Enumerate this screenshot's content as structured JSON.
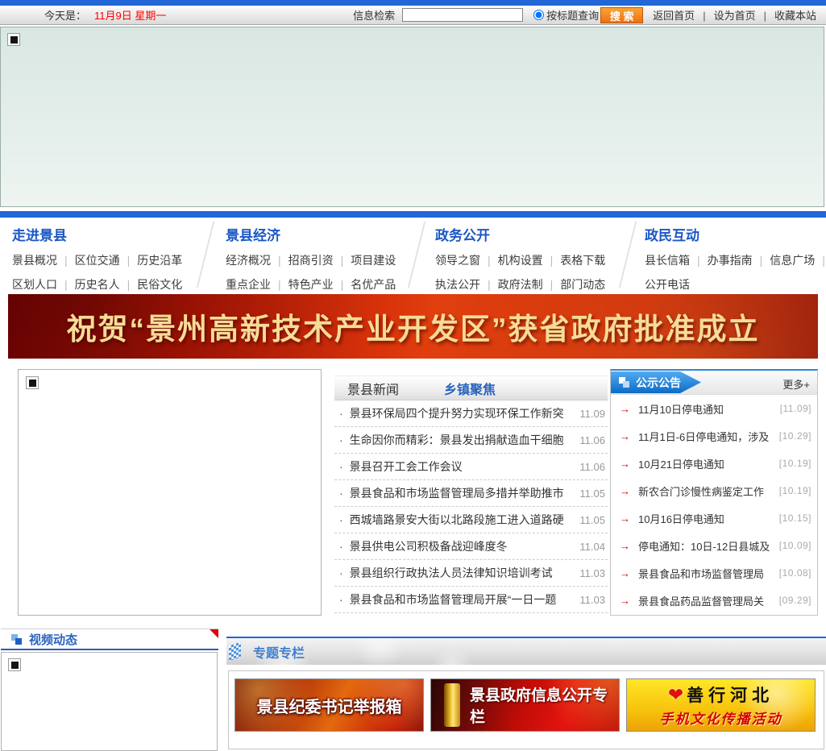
{
  "topbar": {
    "today_label": "今天是：",
    "today_value": "11月9日 星期一",
    "search_label": "信息检索",
    "radio_label": "按标题查询",
    "search_button": "搜 索",
    "links": [
      "返回首页",
      "设为首页",
      "收藏本站"
    ]
  },
  "nav": {
    "columns": [
      {
        "title": "走进景县",
        "rows": [
          [
            "景县概况",
            "区位交通",
            "历史沿革"
          ],
          [
            "区划人口",
            "历史名人",
            "民俗文化"
          ]
        ]
      },
      {
        "title": "景县经济",
        "rows": [
          [
            "经济概况",
            "招商引资",
            "项目建设"
          ],
          [
            "重点企业",
            "特色产业",
            "名优产品"
          ]
        ]
      },
      {
        "title": "政务公开",
        "rows": [
          [
            "领导之窗",
            "机构设置",
            "表格下载"
          ],
          [
            "执法公开",
            "政府法制",
            "部门动态"
          ]
        ]
      },
      {
        "title": "政民互动",
        "rows": [
          [
            "县长信箱",
            "办事指南",
            "信息广场"
          ],
          [
            "公开电话"
          ]
        ]
      }
    ]
  },
  "headline_banner": {
    "text": "祝贺“景州高新技术产业开发区”获省政府批准成立"
  },
  "news": {
    "tabs": [
      "景县新闻",
      "乡镇聚焦"
    ],
    "items": [
      {
        "title": "景县环保局四个提升努力实现环保工作新突",
        "date": "11.09"
      },
      {
        "title": "生命因你而精彩：景县发出捐献造血干细胞",
        "date": "11.06"
      },
      {
        "title": "景县召开工会工作会议",
        "date": "11.06"
      },
      {
        "title": "景县食品和市场监督管理局多措并举助推市",
        "date": "11.05"
      },
      {
        "title": "西城墙路景安大街以北路段施工进入道路硬",
        "date": "11.05"
      },
      {
        "title": "景县供电公司积极备战迎峰度冬",
        "date": "11.04"
      },
      {
        "title": "景县组织行政执法人员法律知识培训考试",
        "date": "11.03"
      },
      {
        "title": "景县食品和市场监督管理局开展“一日一题",
        "date": "11.03"
      }
    ]
  },
  "announcements": {
    "title": "公示公告",
    "more_label": "更多+",
    "items": [
      {
        "title": "11月10日停电通知",
        "date": "[11.09]"
      },
      {
        "title": "11月1日-6日停电通知，涉及",
        "date": "[10.29]"
      },
      {
        "title": "10月21日停电通知",
        "date": "[10.19]"
      },
      {
        "title": "新农合门诊慢性病鉴定工作",
        "date": "[10.19]"
      },
      {
        "title": "10月16日停电通知",
        "date": "[10.15]"
      },
      {
        "title": "停电通知：10日-12日县城及",
        "date": "[10.09]"
      },
      {
        "title": "景县食品和市场监督管理局",
        "date": "[10.08]"
      },
      {
        "title": "景县食品药品监督管理局关",
        "date": "[09.29]"
      }
    ]
  },
  "video_panel": {
    "title": "视频动态"
  },
  "special_section": {
    "title": "专题专栏",
    "banners": [
      {
        "text": "景县纪委书记举报箱"
      },
      {
        "text": "景县政府信息公开专栏"
      },
      {
        "line1": "善行河北",
        "line2": "手机文化传播活动"
      }
    ]
  },
  "icons": {
    "bullet": "·",
    "arrow": "→",
    "heart": "❤"
  },
  "colors": {
    "accent_blue": "#2366d6",
    "button_orange": "#ec7110",
    "date_red": "#ff0000",
    "banner_red": "#c81d05",
    "headline_gold": "#f7dc96",
    "announce_arrow_red": "#d40000"
  }
}
